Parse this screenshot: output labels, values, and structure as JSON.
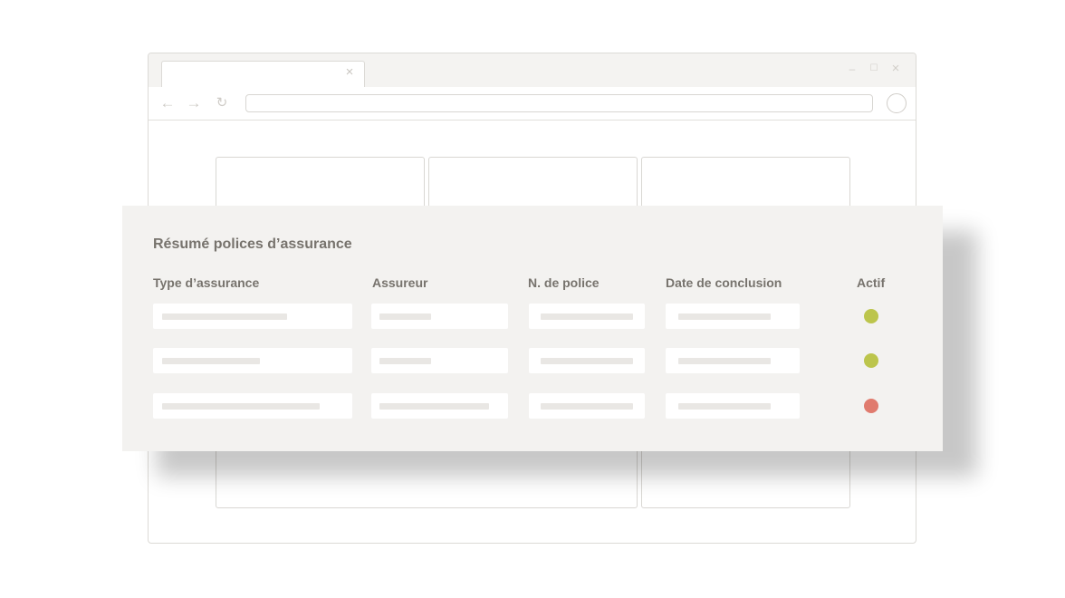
{
  "window": {
    "tab_close": "×",
    "controls": {
      "minimize": "–",
      "maximize": "☐",
      "close": "×"
    },
    "nav": {
      "back": "←",
      "forward": "→",
      "reload": "↻"
    }
  },
  "panel": {
    "title": "Résumé polices d’assurance",
    "columns": [
      "Type d’assurance",
      "Assureur",
      "N. de police",
      "Date de conclusion",
      "Actif"
    ],
    "rows": [
      {
        "active": true,
        "status_color": "#bcc54c"
      },
      {
        "active": true,
        "status_color": "#bcc54c"
      },
      {
        "active": false,
        "status_color": "#e07b6e"
      }
    ]
  }
}
